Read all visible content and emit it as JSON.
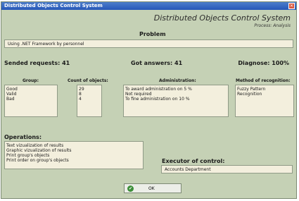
{
  "window": {
    "title": "Distributed Objects Control System"
  },
  "header": {
    "app_title": "Distributed Objects Control System",
    "subtitle": "Process: Analysis"
  },
  "problem": {
    "label": "Problem",
    "value": "Using .NET Framework by personnel"
  },
  "stats": {
    "sended": "Sended requests: 41",
    "got": "Got answers: 41",
    "diagnose": "Diagnose: 100%"
  },
  "group": {
    "label": "Group:",
    "items": [
      "Good",
      "Valid",
      "Bad"
    ]
  },
  "count": {
    "label": "Count of objects:",
    "items": [
      "29",
      "8",
      "4"
    ]
  },
  "administration": {
    "label": "Administration:",
    "items": [
      "To award administration on 5 %",
      "Not required",
      "To fine administration on 10 %"
    ]
  },
  "method": {
    "label": "Method of recognition:",
    "items": [
      "Fuzzy Pattern",
      "Recognition"
    ]
  },
  "operations": {
    "label": "Operations:",
    "items": [
      "Text vizualization of results",
      "Graphic vizualization of results",
      "Print group's objects",
      "Print order on group's objects"
    ]
  },
  "executor": {
    "label": "Executor of control:",
    "value": "Accounts Department"
  },
  "ok_button": {
    "label": "OK",
    "icon": "check-icon"
  },
  "colors": {
    "title_bar": "#2f62c0",
    "window_bg": "#c5d1b5",
    "field_bg": "#f3efdd"
  }
}
